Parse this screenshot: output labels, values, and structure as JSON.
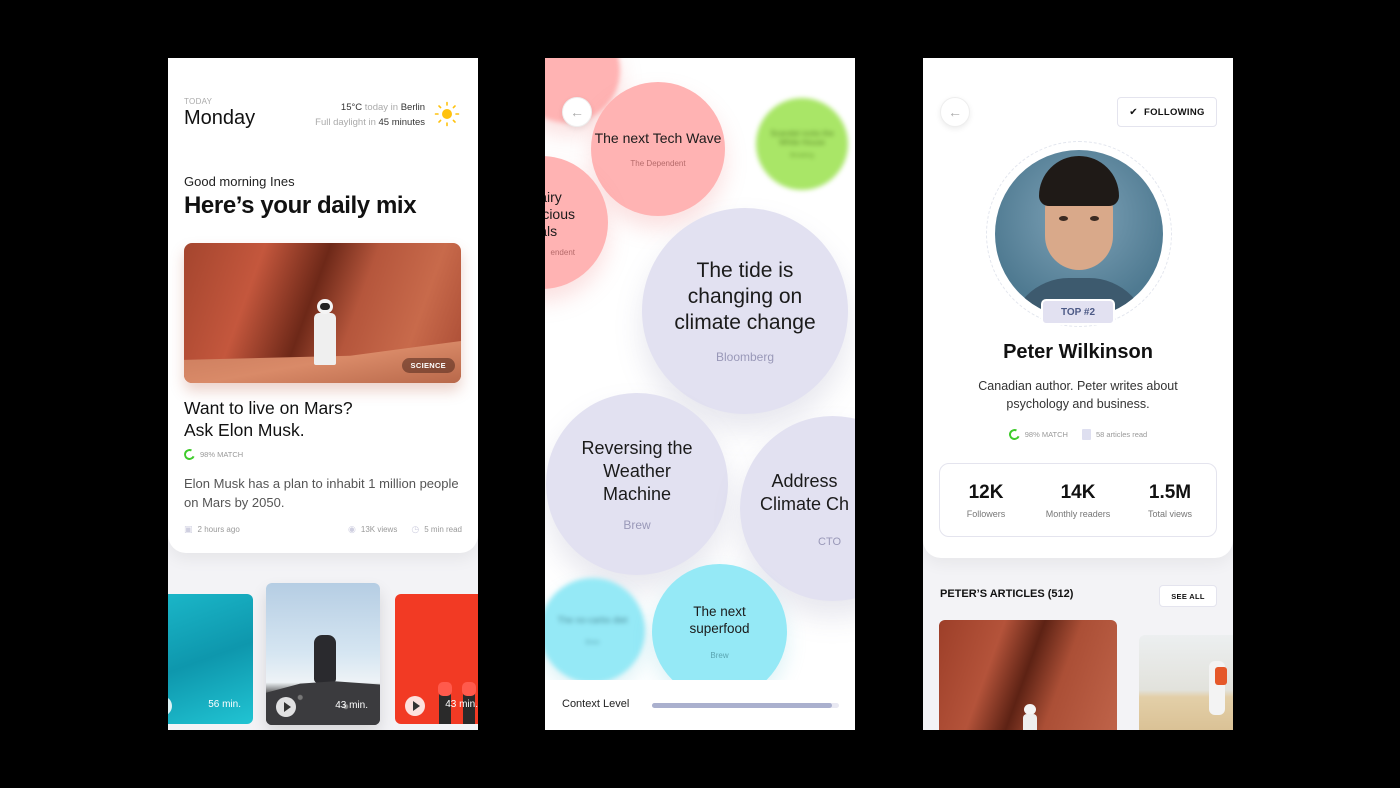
{
  "screen1": {
    "today_label": "TODAY",
    "day": "Monday",
    "weather": {
      "temp": "15°C",
      "today_in": "today in",
      "city": "Berlin",
      "daylight_prefix": "Full daylight in",
      "daylight_value": "45 minutes",
      "icon": "sun-icon"
    },
    "greeting": "Good morning Ines",
    "title": "Here’s your daily mix",
    "featured": {
      "tag": "SCIENCE",
      "headline_line1": "Want to live on Mars?",
      "headline_line2": "Ask Elon Musk.",
      "match": "98% MATCH",
      "description": "Elon Musk has a plan to inhabit 1 million people on Mars by 2050.",
      "time_ago": "2 hours ago",
      "views": "13K views",
      "read_time": "5 min read"
    },
    "videos": [
      {
        "duration": "56 min.",
        "color": "#1bb7c9"
      },
      {
        "duration": "43 min.",
        "color": "#b5cde3"
      },
      {
        "duration": "43 min.",
        "color": "#f23a24"
      }
    ]
  },
  "screen2": {
    "bubbles": [
      {
        "title": "The next Tech Wave",
        "source": "The Dependent",
        "color": "#ffb3b3"
      },
      {
        "title": "Scandal rocks the White House",
        "source": "Breaking",
        "color": "#a9e667"
      },
      {
        "title": "Dairy delicious meals",
        "title_visible": "airy\nicious\nals",
        "source": "The Dependent",
        "source_visible": "endent",
        "color": "#ffb3b3"
      },
      {
        "title": "The tide is changing on climate change",
        "source": "Bloomberg",
        "color": "#e2e1f1"
      },
      {
        "title": "Reversing the Weather Machine",
        "source": "Brew",
        "color": "#e2e1f1"
      },
      {
        "title": "Addressing Climate Change",
        "title_visible": "Address\nClimate Ch",
        "source": "CTO",
        "color": "#e2e1f1"
      },
      {
        "title": "The no-carbs diet",
        "source": "Brew",
        "color": "#95e9f6"
      },
      {
        "title": "The next superfood",
        "source": "Brew",
        "color": "#95e9f6"
      }
    ],
    "context_label": "Context Level",
    "context_level": 0.96
  },
  "screen3": {
    "follow_label": "FOLLOWING",
    "badge": "TOP #2",
    "name": "Peter Wilkinson",
    "bio": "Canadian author. Peter writes about psychology and business.",
    "match": "98% MATCH",
    "articles_read": "58 articles read",
    "stats": [
      {
        "value": "12K",
        "label": "Followers"
      },
      {
        "value": "14K",
        "label": "Monthly readers"
      },
      {
        "value": "1.5M",
        "label": "Total views"
      }
    ],
    "articles_heading": "PETER’S ARTICLES (512)",
    "see_all": "SEE ALL"
  }
}
